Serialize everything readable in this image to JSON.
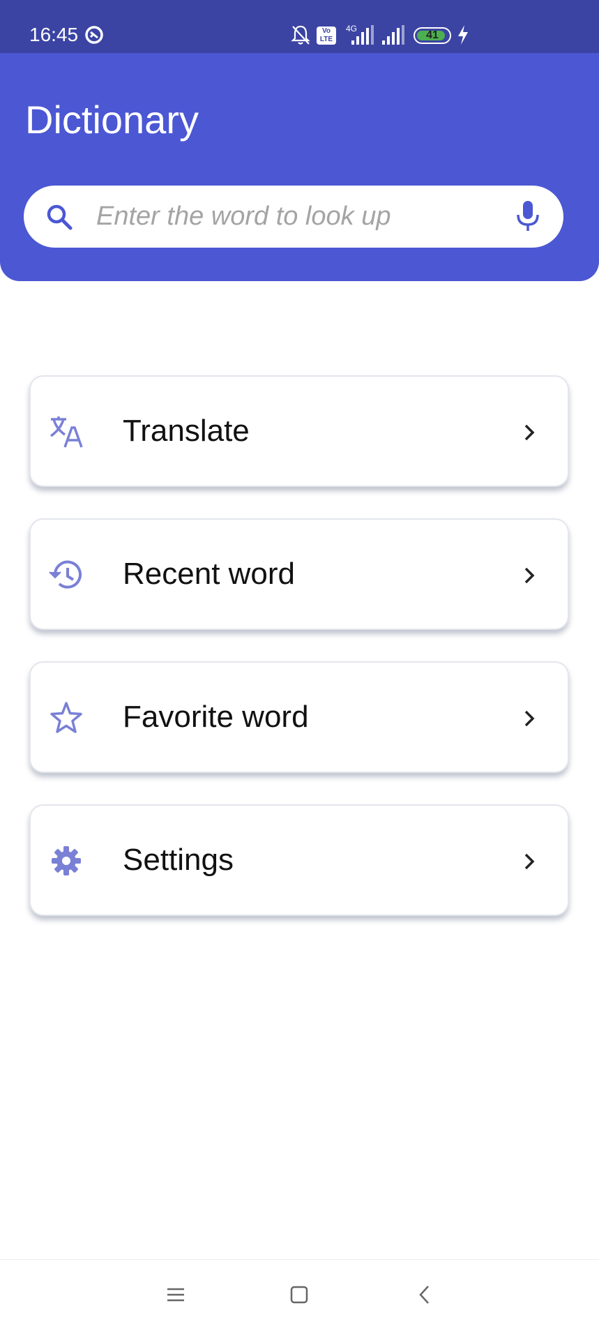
{
  "status_bar": {
    "time": "16:45",
    "network_type": "4G",
    "volte_label": "Vo LTE",
    "battery_level": "41",
    "icons": [
      "data-saver-icon",
      "notifications-off-icon",
      "volte-icon",
      "signal-icon",
      "signal-icon",
      "battery-icon",
      "charging-icon"
    ]
  },
  "app_bar": {
    "title": "Dictionary",
    "background_color": "#4b57d3"
  },
  "search": {
    "placeholder": "Enter the word to look up",
    "value": "",
    "icons": [
      "search-icon",
      "mic-icon"
    ]
  },
  "menu": {
    "items": [
      {
        "label": "Translate",
        "icon": "translate-icon"
      },
      {
        "label": "Recent word",
        "icon": "history-icon"
      },
      {
        "label": "Favorite word",
        "icon": "star-icon"
      },
      {
        "label": "Settings",
        "icon": "gear-icon"
      }
    ],
    "icon_color": "#7a80d6"
  },
  "nav_bar": {
    "buttons": [
      "menu-icon",
      "home-icon",
      "back-icon"
    ]
  }
}
